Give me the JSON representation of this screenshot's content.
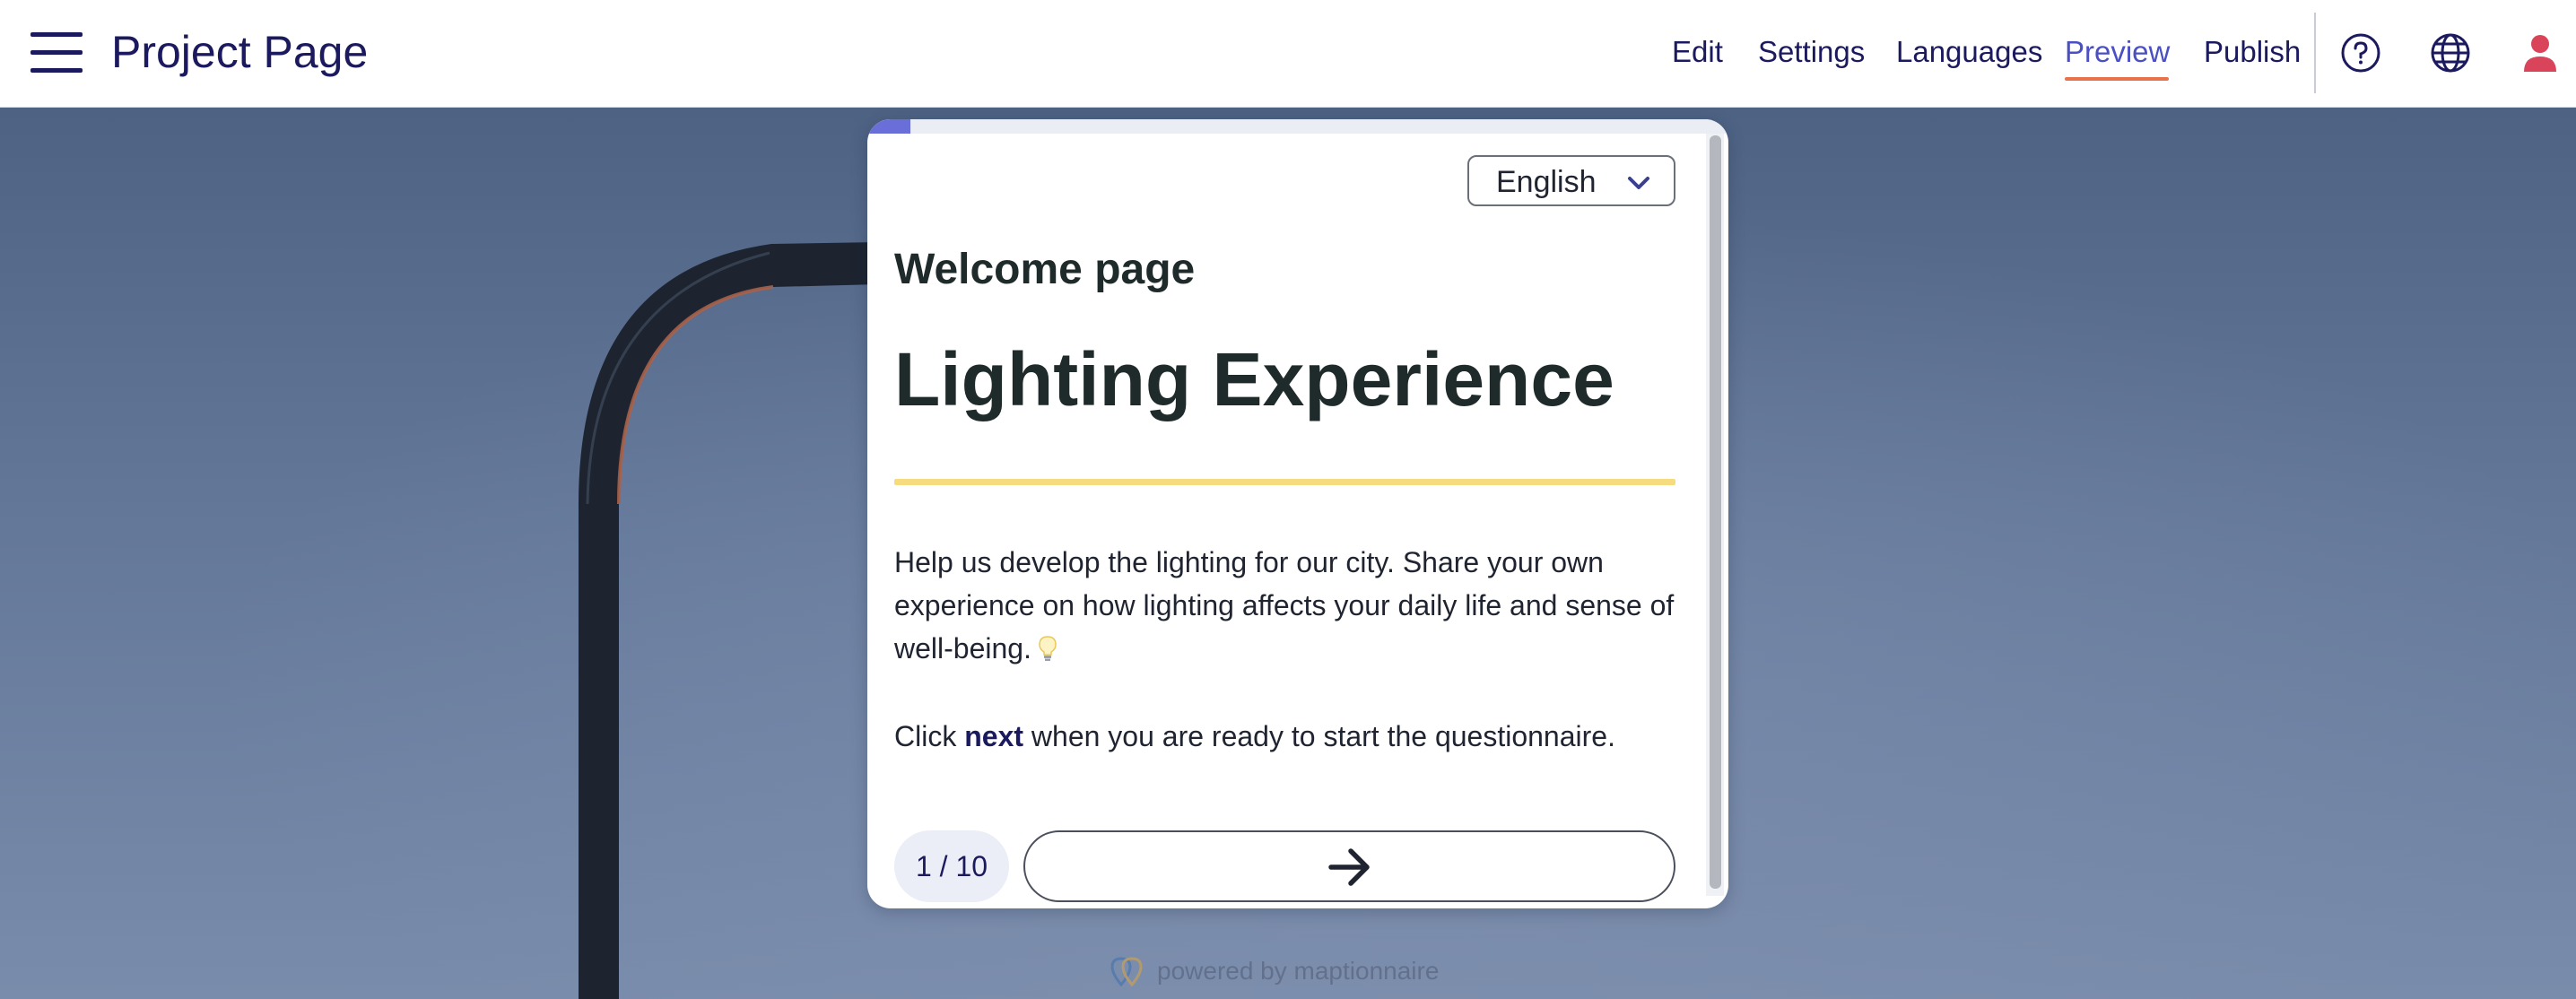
{
  "header": {
    "title": "Project Page",
    "nav": [
      {
        "label": "Edit",
        "active": false
      },
      {
        "label": "Settings",
        "active": false
      },
      {
        "label": "Languages",
        "active": false
      },
      {
        "label": "Preview",
        "active": true
      },
      {
        "label": "Publish",
        "active": false
      }
    ],
    "icons": [
      "menu-icon",
      "help-icon",
      "globe-icon",
      "user-icon"
    ]
  },
  "survey": {
    "progress": 0.1,
    "language": "English",
    "page_heading": "Welcome page",
    "title": "Lighting Experience",
    "intro": "Help us develop the lighting for our city. Share your own experience on how lighting affects your daily life and sense of well-being.",
    "intro_icon": "lightbulb-icon",
    "cta_prefix": "Click",
    "cta_keyword": "next",
    "cta_suffix": "when you are ready to start the questionnaire.",
    "page_counter": "1 / 10",
    "next_icon": "arrow-right-icon"
  },
  "footer": {
    "powered_by": "powered by maptionnaire"
  },
  "colors": {
    "brand_navy": "#1c1a5e",
    "active_nav": "#4a4fc4",
    "active_underline": "#e8734a",
    "progress": "#6a6ed8",
    "title_rule": "#f6dc7f",
    "user_icon": "#d9445a"
  }
}
